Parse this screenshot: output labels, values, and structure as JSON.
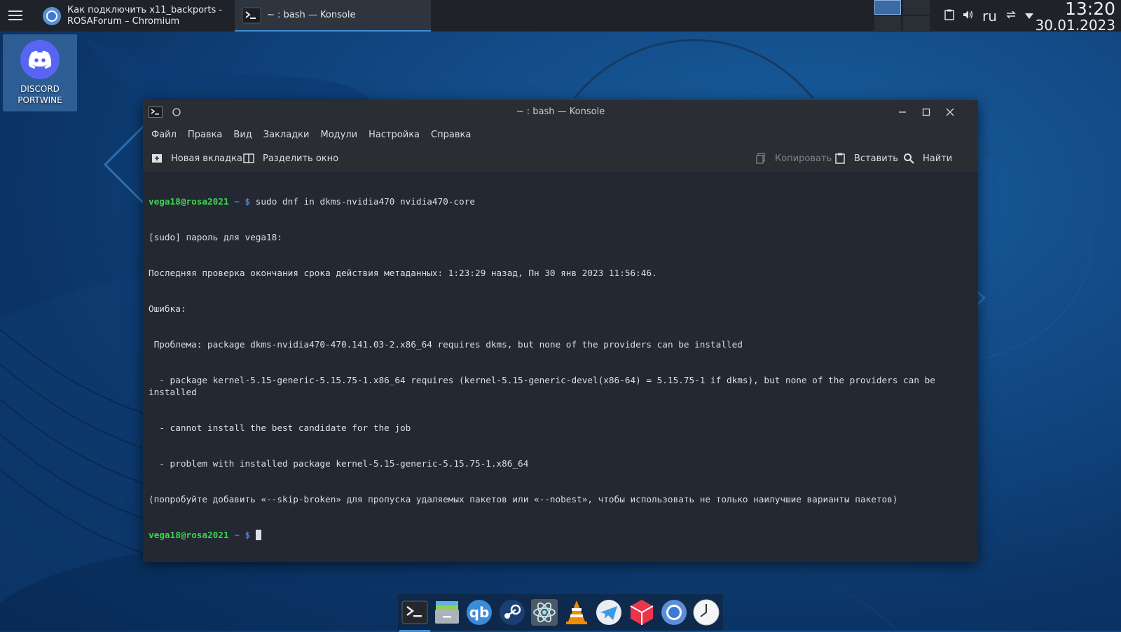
{
  "taskbar": {
    "tasks": [
      {
        "icon": "chromium-icon",
        "label_line1": "Как подключить x11_backports -",
        "label_line2": "ROSAForum – Chromium"
      },
      {
        "icon": "terminal-icon",
        "label": "~ : bash — Konsole"
      }
    ],
    "tray": {
      "keyboard_layout": "ru"
    },
    "clock": {
      "time": "13:20",
      "date": "30.01.2023"
    }
  },
  "desktop": {
    "icons": [
      {
        "label_line1": "DISCORD",
        "label_line2": "PORTWINE",
        "icon": "discord-icon"
      }
    ]
  },
  "window": {
    "title": "~ : bash — Konsole",
    "menu": [
      "Файл",
      "Правка",
      "Вид",
      "Закладки",
      "Модули",
      "Настройка",
      "Справка"
    ],
    "toolbar": {
      "new_tab": "Новая вкладка",
      "split": "Разделить окно",
      "copy": "Копировать",
      "paste": "Вставить",
      "find": "Найти"
    },
    "terminal": {
      "prompt_user": "vega18@rosa2021",
      "prompt_sep": " ~ $",
      "command": " sudo dnf in dkms-nvidia470 nvidia470-core",
      "output": [
        "[sudo] пароль для vega18:",
        "Последняя проверка окончания срока действия метаданных: 1:23:29 назад, Пн 30 янв 2023 11:56:46.",
        "Ошибка:",
        " Проблема: package dkms-nvidia470-470.141.03-2.x86_64 requires dkms, but none of the providers can be installed",
        "  - package kernel-5.15-generic-5.15.75-1.x86_64 requires (kernel-5.15-generic-devel(x86-64) = 5.15.75-1 if dkms), but none of the providers can be installed",
        "  - cannot install the best candidate for the job",
        "  - problem with installed package kernel-5.15-generic-5.15.75-1.x86_64",
        "(попробуйте добавить «--skip-broken» для пропуска удаляемых пакетов или «--nobest», чтобы использовать не только наилучшие варианты пакетов)"
      ]
    }
  },
  "dock": [
    "terminal-icon",
    "files-icon",
    "qbittorrent-icon",
    "steam-icon",
    "atom-icon",
    "vlc-icon",
    "kotatogram-icon",
    "package-icon",
    "chromium-icon",
    "clock-icon"
  ],
  "colors": {
    "panel": "#1f2329",
    "terminal_bg": "#232832",
    "prompt_user": "#3bd64a",
    "prompt_symbol": "#4d7ef0",
    "accent": "#3d8fd6"
  }
}
